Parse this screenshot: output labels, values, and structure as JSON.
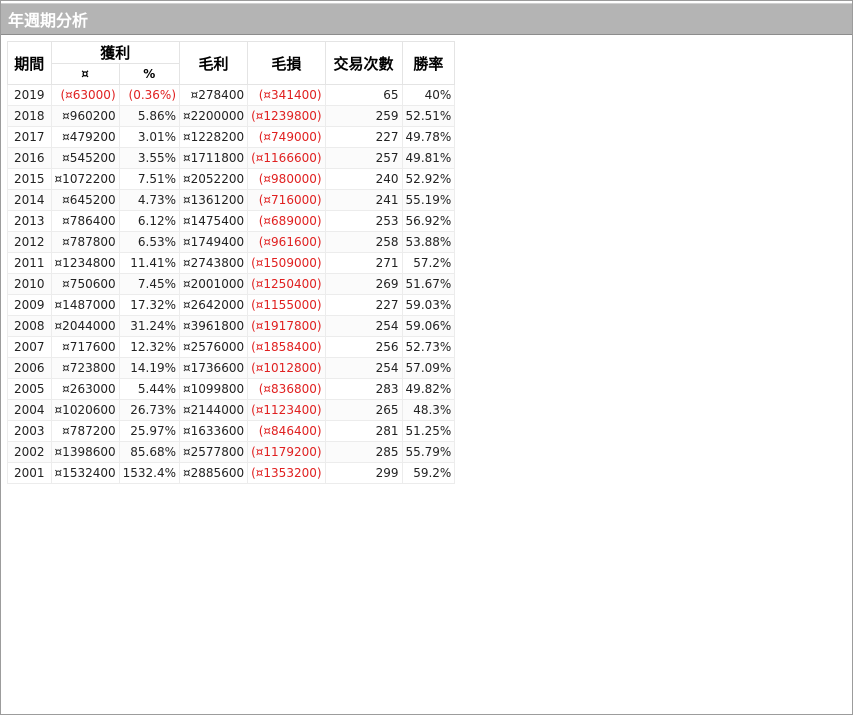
{
  "window": {
    "title": "年週期分析"
  },
  "table": {
    "headers": {
      "period": "期間",
      "profit": "獲利",
      "profit_currency": "¤",
      "profit_percent": "%",
      "gross_profit": "毛利",
      "gross_loss": "毛損",
      "trades": "交易次數",
      "win_rate": "勝率"
    },
    "rows": [
      {
        "year": "2019",
        "profit": "(¤63000)",
        "pct": "(0.36%)",
        "gross_profit": "¤278400",
        "gross_loss": "(¤341400)",
        "trades": "65",
        "win_rate": "40%",
        "neg": true
      },
      {
        "year": "2018",
        "profit": "¤960200",
        "pct": "5.86%",
        "gross_profit": "¤2200000",
        "gross_loss": "(¤1239800)",
        "trades": "259",
        "win_rate": "52.51%",
        "neg": false
      },
      {
        "year": "2017",
        "profit": "¤479200",
        "pct": "3.01%",
        "gross_profit": "¤1228200",
        "gross_loss": "(¤749000)",
        "trades": "227",
        "win_rate": "49.78%",
        "neg": false
      },
      {
        "year": "2016",
        "profit": "¤545200",
        "pct": "3.55%",
        "gross_profit": "¤1711800",
        "gross_loss": "(¤1166600)",
        "trades": "257",
        "win_rate": "49.81%",
        "neg": false
      },
      {
        "year": "2015",
        "profit": "¤1072200",
        "pct": "7.51%",
        "gross_profit": "¤2052200",
        "gross_loss": "(¤980000)",
        "trades": "240",
        "win_rate": "52.92%",
        "neg": false
      },
      {
        "year": "2014",
        "profit": "¤645200",
        "pct": "4.73%",
        "gross_profit": "¤1361200",
        "gross_loss": "(¤716000)",
        "trades": "241",
        "win_rate": "55.19%",
        "neg": false
      },
      {
        "year": "2013",
        "profit": "¤786400",
        "pct": "6.12%",
        "gross_profit": "¤1475400",
        "gross_loss": "(¤689000)",
        "trades": "253",
        "win_rate": "56.92%",
        "neg": false
      },
      {
        "year": "2012",
        "profit": "¤787800",
        "pct": "6.53%",
        "gross_profit": "¤1749400",
        "gross_loss": "(¤961600)",
        "trades": "258",
        "win_rate": "53.88%",
        "neg": false
      },
      {
        "year": "2011",
        "profit": "¤1234800",
        "pct": "11.41%",
        "gross_profit": "¤2743800",
        "gross_loss": "(¤1509000)",
        "trades": "271",
        "win_rate": "57.2%",
        "neg": false
      },
      {
        "year": "2010",
        "profit": "¤750600",
        "pct": "7.45%",
        "gross_profit": "¤2001000",
        "gross_loss": "(¤1250400)",
        "trades": "269",
        "win_rate": "51.67%",
        "neg": false
      },
      {
        "year": "2009",
        "profit": "¤1487000",
        "pct": "17.32%",
        "gross_profit": "¤2642000",
        "gross_loss": "(¤1155000)",
        "trades": "227",
        "win_rate": "59.03%",
        "neg": false
      },
      {
        "year": "2008",
        "profit": "¤2044000",
        "pct": "31.24%",
        "gross_profit": "¤3961800",
        "gross_loss": "(¤1917800)",
        "trades": "254",
        "win_rate": "59.06%",
        "neg": false
      },
      {
        "year": "2007",
        "profit": "¤717600",
        "pct": "12.32%",
        "gross_profit": "¤2576000",
        "gross_loss": "(¤1858400)",
        "trades": "256",
        "win_rate": "52.73%",
        "neg": false
      },
      {
        "year": "2006",
        "profit": "¤723800",
        "pct": "14.19%",
        "gross_profit": "¤1736600",
        "gross_loss": "(¤1012800)",
        "trades": "254",
        "win_rate": "57.09%",
        "neg": false
      },
      {
        "year": "2005",
        "profit": "¤263000",
        "pct": "5.44%",
        "gross_profit": "¤1099800",
        "gross_loss": "(¤836800)",
        "trades": "283",
        "win_rate": "49.82%",
        "neg": false
      },
      {
        "year": "2004",
        "profit": "¤1020600",
        "pct": "26.73%",
        "gross_profit": "¤2144000",
        "gross_loss": "(¤1123400)",
        "trades": "265",
        "win_rate": "48.3%",
        "neg": false
      },
      {
        "year": "2003",
        "profit": "¤787200",
        "pct": "25.97%",
        "gross_profit": "¤1633600",
        "gross_loss": "(¤846400)",
        "trades": "281",
        "win_rate": "51.25%",
        "neg": false
      },
      {
        "year": "2002",
        "profit": "¤1398600",
        "pct": "85.68%",
        "gross_profit": "¤2577800",
        "gross_loss": "(¤1179200)",
        "trades": "285",
        "win_rate": "55.79%",
        "neg": false
      },
      {
        "year": "2001",
        "profit": "¤1532400",
        "pct": "1532.4%",
        "gross_profit": "¤2885600",
        "gross_loss": "(¤1353200)",
        "trades": "299",
        "win_rate": "59.2%",
        "neg": false
      }
    ]
  },
  "colors": {
    "negative": "#e02020",
    "title_bar": "#b4b4b4"
  }
}
